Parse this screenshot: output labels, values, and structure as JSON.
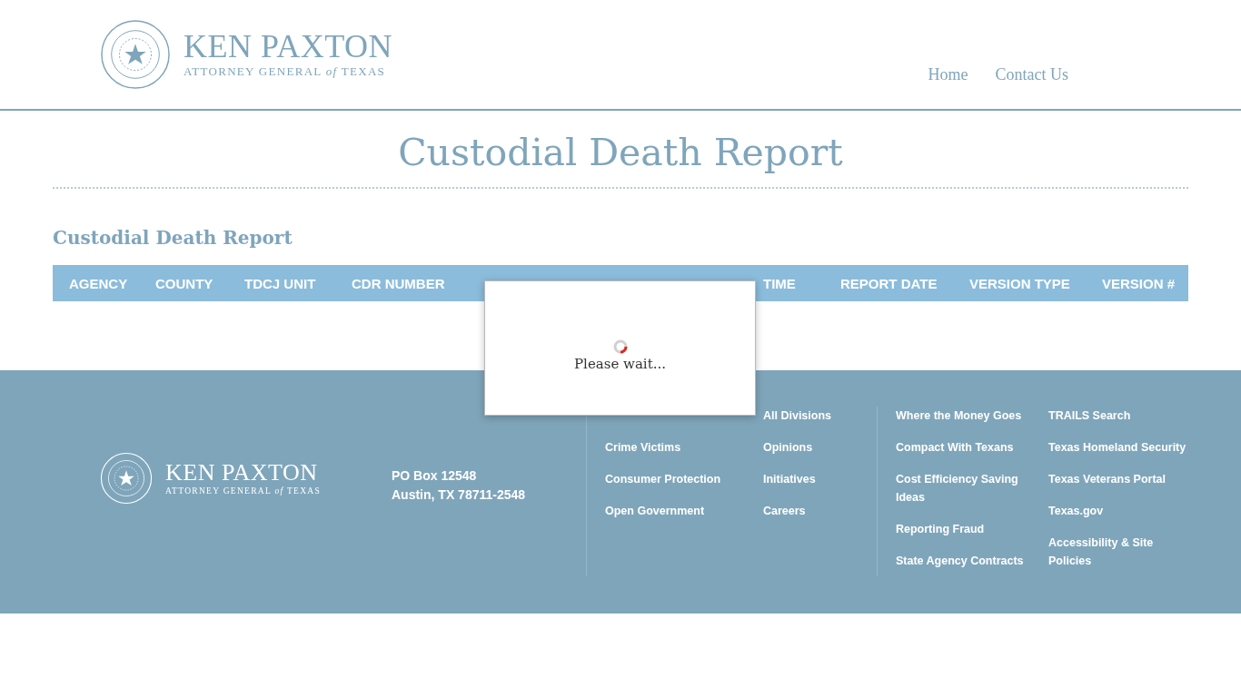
{
  "header": {
    "logo": {
      "name": "KEN PAXTON",
      "tagline": "ATTORNEY GENERAL *of* TEXAS"
    },
    "nav": [
      {
        "label": "Home"
      },
      {
        "label": "Contact Us"
      }
    ]
  },
  "page_title": "Custodial Death Report",
  "section_title": "Custodial Death Report",
  "table": {
    "columns": [
      {
        "label": "AGENCY"
      },
      {
        "label": "COUNTY"
      },
      {
        "label": "TDCJ UNIT"
      },
      {
        "label": "CDR NUMBER"
      },
      {
        "label": "TIME"
      },
      {
        "label": "REPORT DATE"
      },
      {
        "label": "VERSION TYPE"
      },
      {
        "label": "VERSION #"
      }
    ]
  },
  "dialog": {
    "message": "Please wait..."
  },
  "footer": {
    "logo": {
      "name": "KEN PAXTON",
      "tagline": "ATTORNEY GENERAL *of* TEXAS"
    },
    "address": [
      "PO Box 12548",
      "Austin, TX 78711-2548"
    ],
    "link_groups": [
      [
        [
          "Crime Victims",
          "Consumer Protection",
          "Open Government"
        ],
        [
          "All Divisions",
          "Opinions",
          "Initiatives",
          "Careers"
        ]
      ],
      [
        [
          "Where the Money Goes",
          "Compact With Texans",
          "Cost Efficiency Saving Ideas",
          "Reporting Fraud",
          "State Agency Contracts"
        ],
        [
          "TRAILS Search",
          "Texas Homeland Security",
          "Texas Veterans Portal",
          "Texas.gov",
          "Accessibility & Site Policies"
        ]
      ]
    ]
  }
}
